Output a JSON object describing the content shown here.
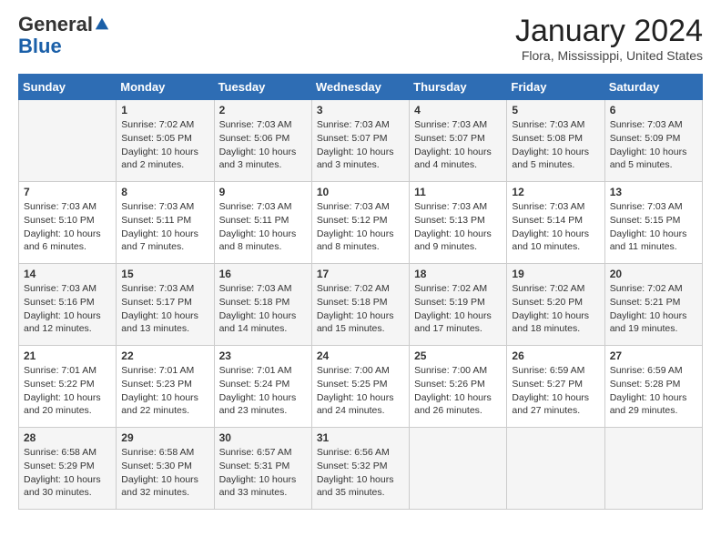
{
  "logo": {
    "general": "General",
    "blue": "Blue"
  },
  "title": "January 2024",
  "location": "Flora, Mississippi, United States",
  "days_of_week": [
    "Sunday",
    "Monday",
    "Tuesday",
    "Wednesday",
    "Thursday",
    "Friday",
    "Saturday"
  ],
  "weeks": [
    [
      {
        "day": "",
        "content": ""
      },
      {
        "day": "1",
        "content": "Sunrise: 7:02 AM\nSunset: 5:05 PM\nDaylight: 10 hours\nand 2 minutes."
      },
      {
        "day": "2",
        "content": "Sunrise: 7:03 AM\nSunset: 5:06 PM\nDaylight: 10 hours\nand 3 minutes."
      },
      {
        "day": "3",
        "content": "Sunrise: 7:03 AM\nSunset: 5:07 PM\nDaylight: 10 hours\nand 3 minutes."
      },
      {
        "day": "4",
        "content": "Sunrise: 7:03 AM\nSunset: 5:07 PM\nDaylight: 10 hours\nand 4 minutes."
      },
      {
        "day": "5",
        "content": "Sunrise: 7:03 AM\nSunset: 5:08 PM\nDaylight: 10 hours\nand 5 minutes."
      },
      {
        "day": "6",
        "content": "Sunrise: 7:03 AM\nSunset: 5:09 PM\nDaylight: 10 hours\nand 5 minutes."
      }
    ],
    [
      {
        "day": "7",
        "content": "Sunrise: 7:03 AM\nSunset: 5:10 PM\nDaylight: 10 hours\nand 6 minutes."
      },
      {
        "day": "8",
        "content": "Sunrise: 7:03 AM\nSunset: 5:11 PM\nDaylight: 10 hours\nand 7 minutes."
      },
      {
        "day": "9",
        "content": "Sunrise: 7:03 AM\nSunset: 5:11 PM\nDaylight: 10 hours\nand 8 minutes."
      },
      {
        "day": "10",
        "content": "Sunrise: 7:03 AM\nSunset: 5:12 PM\nDaylight: 10 hours\nand 8 minutes."
      },
      {
        "day": "11",
        "content": "Sunrise: 7:03 AM\nSunset: 5:13 PM\nDaylight: 10 hours\nand 9 minutes."
      },
      {
        "day": "12",
        "content": "Sunrise: 7:03 AM\nSunset: 5:14 PM\nDaylight: 10 hours\nand 10 minutes."
      },
      {
        "day": "13",
        "content": "Sunrise: 7:03 AM\nSunset: 5:15 PM\nDaylight: 10 hours\nand 11 minutes."
      }
    ],
    [
      {
        "day": "14",
        "content": "Sunrise: 7:03 AM\nSunset: 5:16 PM\nDaylight: 10 hours\nand 12 minutes."
      },
      {
        "day": "15",
        "content": "Sunrise: 7:03 AM\nSunset: 5:17 PM\nDaylight: 10 hours\nand 13 minutes."
      },
      {
        "day": "16",
        "content": "Sunrise: 7:03 AM\nSunset: 5:18 PM\nDaylight: 10 hours\nand 14 minutes."
      },
      {
        "day": "17",
        "content": "Sunrise: 7:02 AM\nSunset: 5:18 PM\nDaylight: 10 hours\nand 15 minutes."
      },
      {
        "day": "18",
        "content": "Sunrise: 7:02 AM\nSunset: 5:19 PM\nDaylight: 10 hours\nand 17 minutes."
      },
      {
        "day": "19",
        "content": "Sunrise: 7:02 AM\nSunset: 5:20 PM\nDaylight: 10 hours\nand 18 minutes."
      },
      {
        "day": "20",
        "content": "Sunrise: 7:02 AM\nSunset: 5:21 PM\nDaylight: 10 hours\nand 19 minutes."
      }
    ],
    [
      {
        "day": "21",
        "content": "Sunrise: 7:01 AM\nSunset: 5:22 PM\nDaylight: 10 hours\nand 20 minutes."
      },
      {
        "day": "22",
        "content": "Sunrise: 7:01 AM\nSunset: 5:23 PM\nDaylight: 10 hours\nand 22 minutes."
      },
      {
        "day": "23",
        "content": "Sunrise: 7:01 AM\nSunset: 5:24 PM\nDaylight: 10 hours\nand 23 minutes."
      },
      {
        "day": "24",
        "content": "Sunrise: 7:00 AM\nSunset: 5:25 PM\nDaylight: 10 hours\nand 24 minutes."
      },
      {
        "day": "25",
        "content": "Sunrise: 7:00 AM\nSunset: 5:26 PM\nDaylight: 10 hours\nand 26 minutes."
      },
      {
        "day": "26",
        "content": "Sunrise: 6:59 AM\nSunset: 5:27 PM\nDaylight: 10 hours\nand 27 minutes."
      },
      {
        "day": "27",
        "content": "Sunrise: 6:59 AM\nSunset: 5:28 PM\nDaylight: 10 hours\nand 29 minutes."
      }
    ],
    [
      {
        "day": "28",
        "content": "Sunrise: 6:58 AM\nSunset: 5:29 PM\nDaylight: 10 hours\nand 30 minutes."
      },
      {
        "day": "29",
        "content": "Sunrise: 6:58 AM\nSunset: 5:30 PM\nDaylight: 10 hours\nand 32 minutes."
      },
      {
        "day": "30",
        "content": "Sunrise: 6:57 AM\nSunset: 5:31 PM\nDaylight: 10 hours\nand 33 minutes."
      },
      {
        "day": "31",
        "content": "Sunrise: 6:56 AM\nSunset: 5:32 PM\nDaylight: 10 hours\nand 35 minutes."
      },
      {
        "day": "",
        "content": ""
      },
      {
        "day": "",
        "content": ""
      },
      {
        "day": "",
        "content": ""
      }
    ]
  ]
}
